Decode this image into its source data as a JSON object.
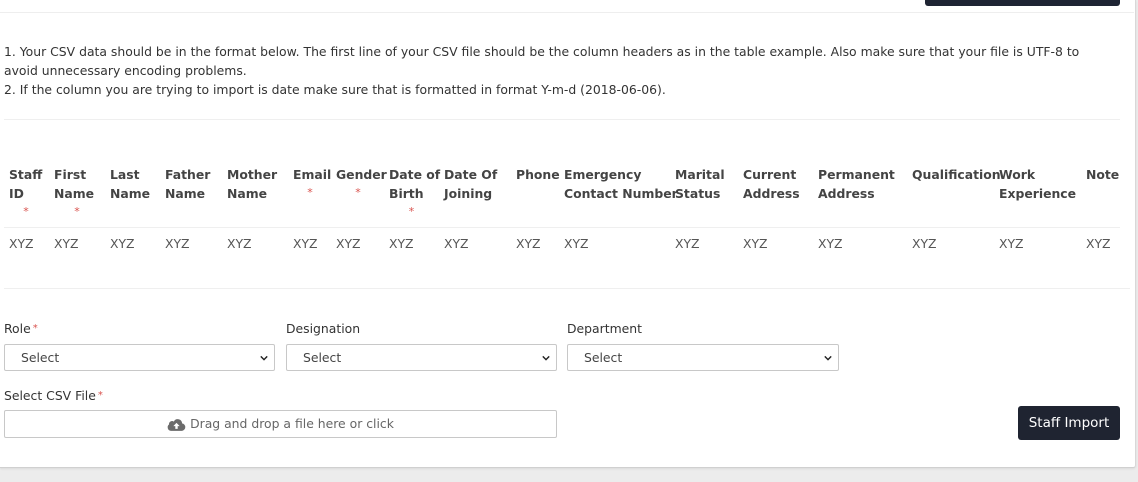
{
  "instructions": {
    "line1": "1. Your CSV data should be in the format below. The first line of your CSV file should be the column headers as in the table example. Also make sure that your file is UTF-8 to avoid unnecessary encoding problems.",
    "line2": "2. If the column you are trying to import is date make sure that is formatted in format Y-m-d (2018-06-06)."
  },
  "table": {
    "headers": [
      {
        "line1": "Staff",
        "line2": "ID",
        "required": true
      },
      {
        "line1": "First",
        "line2": "Name",
        "required": true
      },
      {
        "line1": "Last",
        "line2": "Name",
        "required": false
      },
      {
        "line1": "Father",
        "line2": "Name",
        "required": false
      },
      {
        "line1": "Mother",
        "line2": "Name",
        "required": false
      },
      {
        "line1": "Email",
        "line2": "",
        "required": true
      },
      {
        "line1": "Gender",
        "line2": "",
        "required": true
      },
      {
        "line1": "Date of",
        "line2": "Birth",
        "required": true
      },
      {
        "line1": "Date Of",
        "line2": "Joining",
        "required": false
      },
      {
        "line1": "Phone",
        "line2": "",
        "required": false
      },
      {
        "line1": "Emergency",
        "line2": "Contact Number",
        "required": false
      },
      {
        "line1": "Marital",
        "line2": "Status",
        "required": false
      },
      {
        "line1": "Current",
        "line2": "Address",
        "required": false
      },
      {
        "line1": "Permanent",
        "line2": "Address",
        "required": false
      },
      {
        "line1": "Qualification",
        "line2": "",
        "required": false
      },
      {
        "line1": "Work",
        "line2": "Experience",
        "required": false
      },
      {
        "line1": "Note",
        "line2": "",
        "required": false
      }
    ],
    "required_marker": "*",
    "row": [
      "XYZ",
      "XYZ",
      "XYZ",
      "XYZ",
      "XYZ",
      "XYZ",
      "XYZ",
      "XYZ",
      "XYZ",
      "XYZ",
      "XYZ",
      "XYZ",
      "XYZ",
      "XYZ",
      "XYZ",
      "XYZ",
      "XYZ"
    ]
  },
  "form": {
    "role": {
      "label": "Role",
      "required_marker": "*",
      "value": "Select"
    },
    "designation": {
      "label": "Designation",
      "value": "Select"
    },
    "department": {
      "label": "Department",
      "value": "Select"
    },
    "csv_file": {
      "label": "Select CSV File",
      "required_marker": "*",
      "dropzone_text": "Drag and drop a file here or click",
      "icon": "cloud-upload-icon"
    },
    "submit_label": "Staff Import"
  },
  "colors": {
    "button_bg": "#1f2431",
    "required": "#d9534f"
  }
}
